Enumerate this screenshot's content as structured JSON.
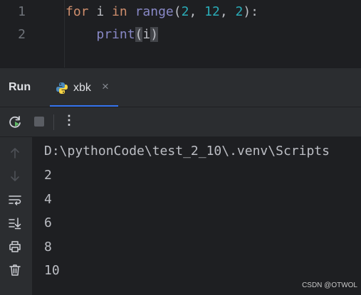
{
  "editor": {
    "line_numbers": [
      "1",
      "2"
    ],
    "line1": {
      "kw_for": "for",
      "var": " i ",
      "kw_in": "in",
      "sp": " ",
      "fn": "range",
      "open": "(",
      "a1": "2",
      "c1": ", ",
      "a2": "12",
      "c2": ", ",
      "a3": "2",
      "close": "):"
    },
    "line2": {
      "indent": "    ",
      "fn": "print",
      "open": "(",
      "arg": "i",
      "close": ")"
    }
  },
  "run_panel": {
    "title": "Run",
    "tab_label": "xbk",
    "close_glyph": "×",
    "kebab_glyph": "⋮"
  },
  "console": {
    "lines": [
      "D:\\pythonCode\\test_2_10\\.venv\\Scripts",
      "2",
      "4",
      "6",
      "8",
      "10"
    ]
  },
  "watermark": "CSDN @OTWOL",
  "colors": {
    "keyword": "#cf8e6d",
    "function": "#56a8f5",
    "number": "#2aacb8",
    "builtin": "#8888c6",
    "accent": "#3574f0"
  }
}
